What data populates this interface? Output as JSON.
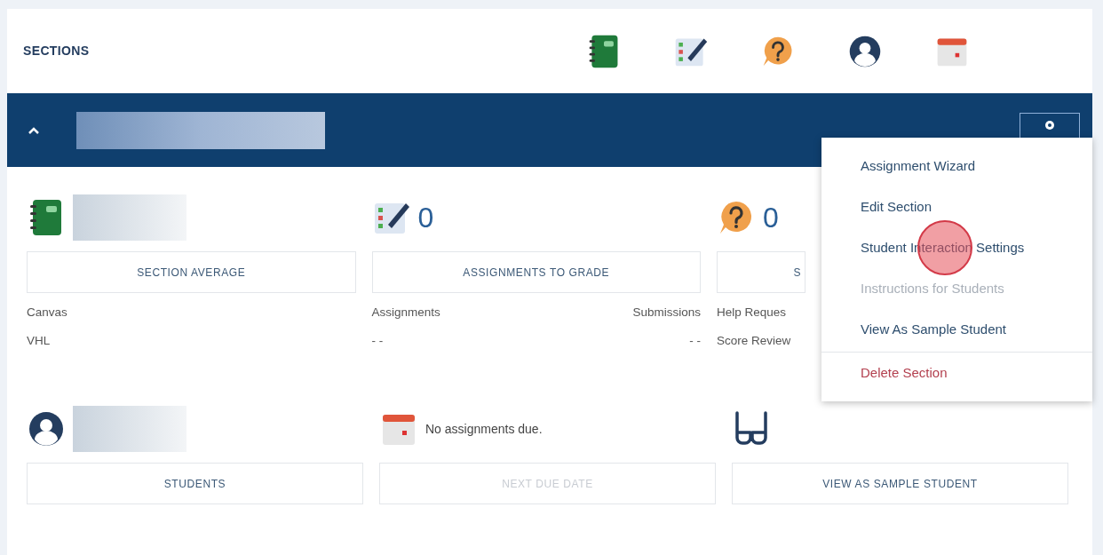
{
  "header": {
    "title": "SECTIONS",
    "icons": [
      {
        "kind": "notebook"
      },
      {
        "kind": "checklist"
      },
      {
        "kind": "help"
      },
      {
        "kind": "user"
      },
      {
        "kind": "calendar"
      }
    ]
  },
  "section_bar": {
    "expanded": true
  },
  "cards": [
    {
      "kind": "notebook",
      "redacted": true,
      "button": {
        "label": "SECTION AVERAGE",
        "disabled": false
      },
      "rows": [
        {
          "left": "Canvas"
        },
        {
          "left": "VHL"
        }
      ]
    },
    {
      "kind": "checklist",
      "value": "0",
      "button": {
        "label": "ASSIGNMENTS TO GRADE",
        "disabled": false
      },
      "rows": [
        {
          "left": "Assignments",
          "right": "Submissions"
        },
        {
          "left": "- -",
          "right": "- -"
        }
      ]
    },
    {
      "kind": "help",
      "value": "0",
      "covered": true,
      "button": {
        "label": "S",
        "disabled": false
      },
      "rows": [
        {
          "left": "Help Reques"
        },
        {
          "left": "Score Review"
        }
      ]
    },
    {
      "kind": "user",
      "redacted": true,
      "button": {
        "label": "STUDENTS",
        "disabled": false
      }
    },
    {
      "kind": "calendar",
      "note": "No assignments due.",
      "button": {
        "label": "NEXT DUE DATE",
        "disabled": true
      }
    },
    {
      "kind": "glasses",
      "button": {
        "label": "VIEW AS SAMPLE STUDENT",
        "disabled": false
      }
    }
  ],
  "menu": {
    "items": [
      {
        "label": "Assignment Wizard",
        "disabled": false,
        "kind": "normal"
      },
      {
        "label": "Edit Section",
        "disabled": false,
        "kind": "normal"
      },
      {
        "label": "Student Interaction Settings",
        "disabled": false,
        "kind": "normal",
        "clicked": true
      },
      {
        "label": "Instructions for Students",
        "disabled": true,
        "kind": "normal"
      },
      {
        "label": "View As Sample Student",
        "disabled": false,
        "kind": "normal"
      },
      {
        "label": "Delete Section",
        "disabled": false,
        "kind": "danger"
      }
    ]
  }
}
